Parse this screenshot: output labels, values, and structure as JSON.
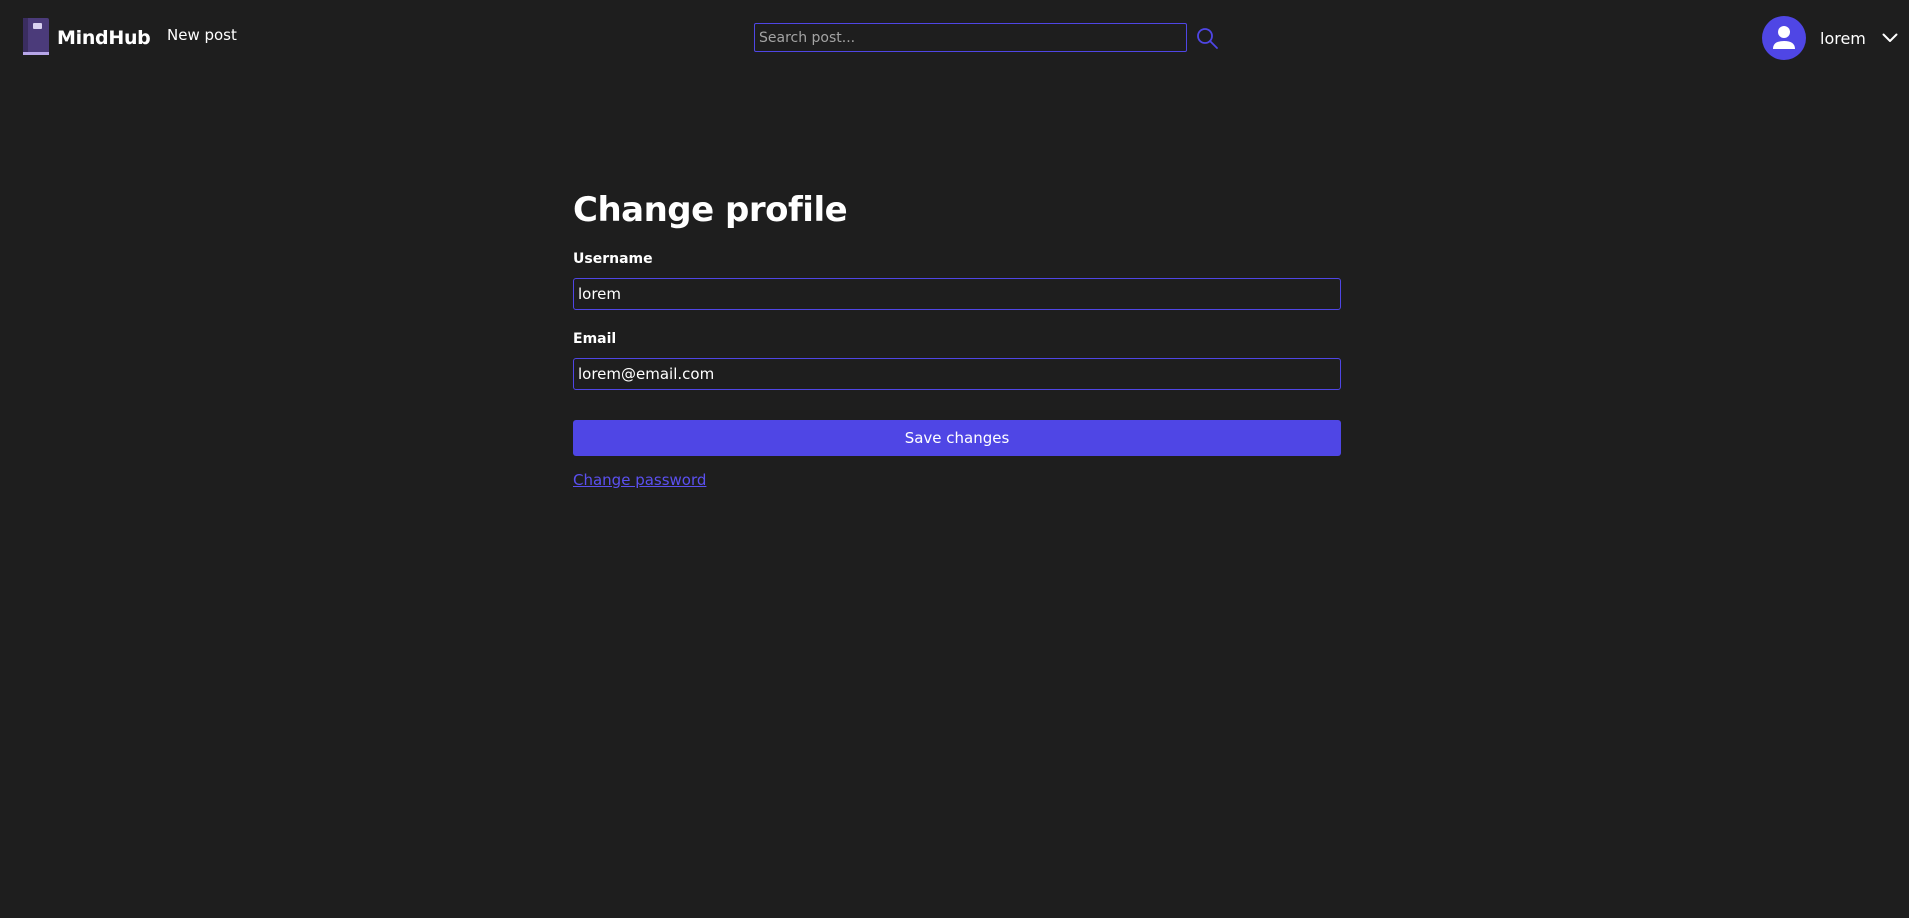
{
  "header": {
    "brand_name": "MindHub",
    "logo_icon": "book-icon",
    "new_post_label": "New post",
    "search": {
      "placeholder": "Search post...",
      "value": "",
      "icon": "search-icon"
    },
    "user": {
      "name": "lorem",
      "avatar_icon": "user-icon",
      "menu_icon": "chevron-down-icon"
    }
  },
  "main": {
    "title": "Change profile",
    "fields": [
      {
        "label": "Username",
        "value": "lorem"
      },
      {
        "label": "Email",
        "value": "lorem@email.com"
      }
    ],
    "save_label": "Save changes",
    "change_password_label": "Change password"
  },
  "colors": {
    "background": "#1e1e1e",
    "accent": "#4f46e5",
    "text": "#ffffff",
    "link": "#5b50f0",
    "logo": "#4b3b7a"
  }
}
